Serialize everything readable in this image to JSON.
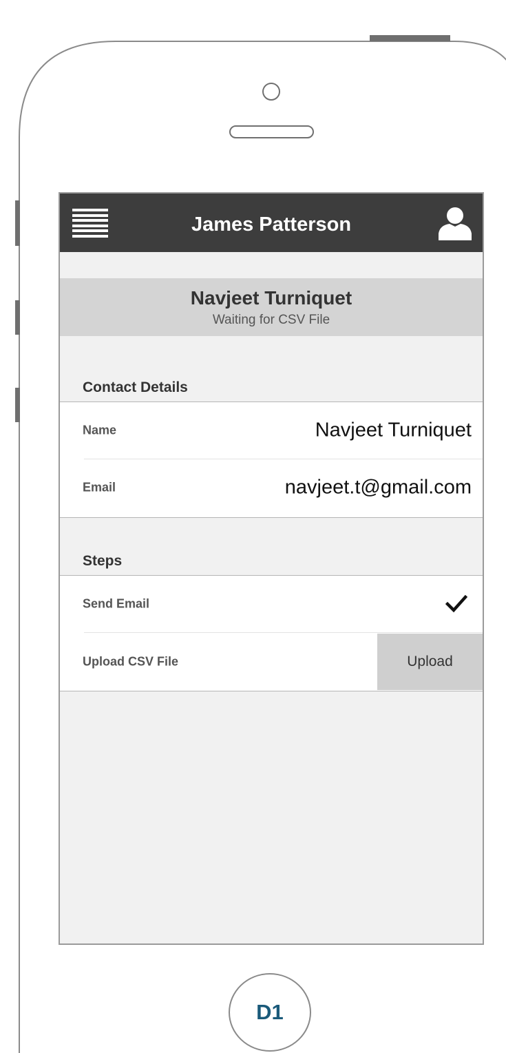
{
  "header": {
    "title": "James Patterson",
    "menu_icon": "hamburger-menu-icon",
    "user_icon": "user-profile-icon"
  },
  "profile": {
    "name": "Navjeet Turniquet",
    "status": "Waiting for CSV File"
  },
  "contact_details": {
    "heading": "Contact Details",
    "rows": [
      {
        "label": "Name",
        "value": "Navjeet Turniquet"
      },
      {
        "label": "Email",
        "value": "navjeet.t@gmail.com"
      }
    ]
  },
  "steps": {
    "heading": "Steps",
    "rows": [
      {
        "label": "Send Email",
        "status_icon": "checkmark-icon"
      },
      {
        "label": "Upload CSV File",
        "action_label": "Upload"
      }
    ]
  },
  "home_button": {
    "label": "D1"
  },
  "colors": {
    "topbar": "#3d3d3d",
    "screen_background": "#f1f1f1",
    "profile_band": "#d4d4d4",
    "upload_button": "#cfcfcf",
    "home_label": "#1a5a7a"
  }
}
